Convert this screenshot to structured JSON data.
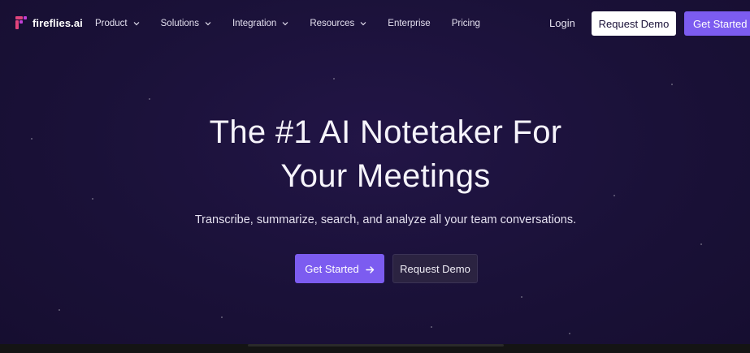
{
  "brand": {
    "name": "fireflies.ai",
    "colors": {
      "accent": "#7c5cf0",
      "background": "#1a1138",
      "logo_pink": "#e0447c",
      "logo_purple": "#c23fd6"
    }
  },
  "nav": {
    "items": [
      {
        "label": "Product",
        "has_dropdown": true,
        "icon": "chevron-down-icon"
      },
      {
        "label": "Solutions",
        "has_dropdown": true,
        "icon": "chevron-down-icon"
      },
      {
        "label": "Integration",
        "has_dropdown": true,
        "icon": "chevron-down-icon"
      },
      {
        "label": "Resources",
        "has_dropdown": true,
        "icon": "chevron-down-icon"
      },
      {
        "label": "Enterprise",
        "has_dropdown": false
      },
      {
        "label": "Pricing",
        "has_dropdown": false
      }
    ],
    "login_label": "Login",
    "request_demo_label": "Request Demo",
    "get_started_label": "Get Started"
  },
  "hero": {
    "title_line1": "The #1 AI Notetaker For",
    "title_line2": "Your Meetings",
    "subtitle": "Transcribe, summarize, search, and analyze all your team conversations.",
    "primary_cta_label": "Get Started",
    "primary_cta_icon": "arrow-right-icon",
    "secondary_cta_label": "Request Demo"
  }
}
